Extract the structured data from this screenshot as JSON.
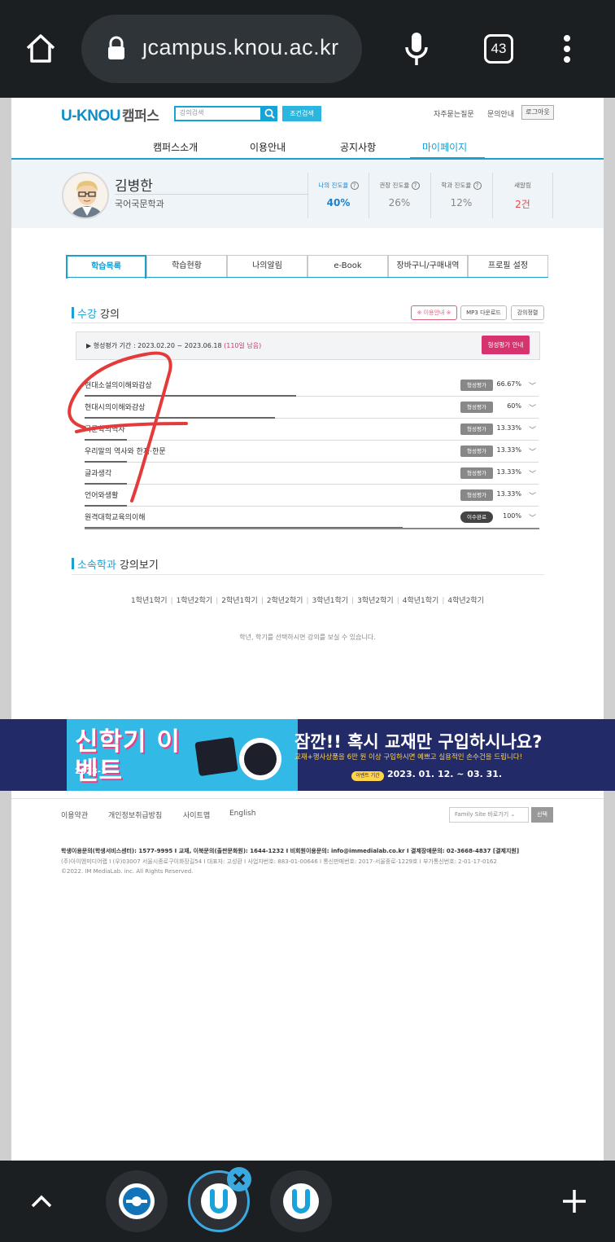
{
  "browser": {
    "url": "ȷcampus.knou.ac.kr",
    "tab_count": "43",
    "icons": {
      "home": "home-icon",
      "lock": "lock-icon",
      "mic": "mic-icon",
      "menu": "more-vert-icon",
      "up": "chevron-up-icon",
      "add": "plus-icon",
      "close": "close-icon"
    }
  },
  "header": {
    "logo": "U-KNOU",
    "logo_suffix": "캠퍼스",
    "search_placeholder": "강의검색",
    "cond_search": "조건검색",
    "links": [
      "자주묻는질문",
      "문의안내"
    ],
    "logout": "로그아웃"
  },
  "gnb": [
    "캠퍼스소개",
    "이용안내",
    "공지사항",
    "마이페이지"
  ],
  "profile": {
    "name": "김병한",
    "dept": "국어국문학과",
    "stats": [
      {
        "label": "나의 진도율",
        "value": "40%"
      },
      {
        "label": "권장 진도율",
        "value": "26%"
      },
      {
        "label": "학과 진도율",
        "value": "12%"
      },
      {
        "label": "새알림",
        "value": "2건"
      }
    ]
  },
  "tabs": [
    "학습목록",
    "학습현황",
    "나의알림",
    "e-Book",
    "장바구니/구매내역",
    "프로필 설정"
  ],
  "enrolled": {
    "title_hl": "수강",
    "title_rest": " 강의",
    "buttons": [
      "※ 이용안내 ※",
      "MP3 다운로드",
      "강의정렬"
    ],
    "period_label": "▶ 형성평가 기간 : 2023.02.20 ~ 2023.06.18",
    "period_left": "(110일 남음)",
    "period_button": "형성평가 안내",
    "courses": [
      {
        "name": "현대소설의이해와감상",
        "badge": "형성평가",
        "pct": "66.67%",
        "progress": 0.6667
      },
      {
        "name": "현대시의이해와감상",
        "badge": "형성평가",
        "pct": "60%",
        "progress": 0.6
      },
      {
        "name": "국문학의역사",
        "badge": "형성평가",
        "pct": "13.33%",
        "progress": 0.1333
      },
      {
        "name": "우리말의 역사와 한자·한문",
        "badge": "형성평가",
        "pct": "13.33%",
        "progress": 0.1333
      },
      {
        "name": "글과생각",
        "badge": "형성평가",
        "pct": "13.33%",
        "progress": 0.1333
      },
      {
        "name": "언어와생활",
        "badge": "형성평가",
        "pct": "13.33%",
        "progress": 0.1333
      },
      {
        "name": "원격대학교육의이해",
        "badge": "이수완료",
        "pct": "100%",
        "progress": 1.0
      }
    ]
  },
  "dept_section": {
    "title_hl": "소속학과",
    "title_rest": " 강의보기",
    "semesters": [
      "1학년1학기",
      "1학년2학기",
      "2학년1학기",
      "2학년2학기",
      "3학년1학기",
      "3학년2학기",
      "4학년1학기",
      "4학년2학기"
    ],
    "hint": "학년, 학기를 선택하시면 강의를 보실 수 있습니다."
  },
  "banner": {
    "year": "2023-1",
    "title": "신학기 이벤트",
    "headline": "잠깐!! 혹시 교재만 구입하시나요?",
    "sub": "교재+행사상품을 6만 원 이상 구입하시면 예쁘고 실용적인 손수건을 드립니다!",
    "period_tag": "이벤트 기간",
    "dates": "2023. 01. 12. ~ 03. 31."
  },
  "footer": {
    "links": [
      "이용약관",
      "개인정보취급방침",
      "사이트맵",
      "English"
    ],
    "family_site": "Family Site 바로가기",
    "family_go": "선택",
    "contact": "학생이용문의(학생서비스센터): 1577-9995  I  교재, 이북문의(출판문화원): 1644-1232  I  비회원이용문의: info@immedialab.co.kr  I  결제장애문의: 02-3668-4837 [결제지원]",
    "company": "(주)아이엠미디어랩  I  (우)03007 서울시종로구이화장길54  I  대표자: 고성환  I  사업자번호: 883-01-00646  I  통신판매번호: 2017-서울종로-1229호  I  부가통신번호: 2-01-17-0162",
    "copyright": "©2022. IM MediaLab. inc. All Rights Reserved."
  }
}
